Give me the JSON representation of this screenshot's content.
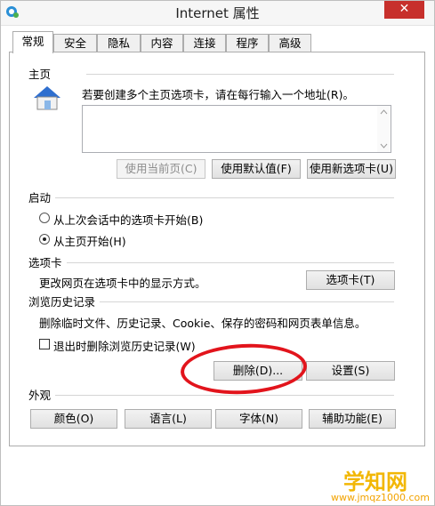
{
  "window": {
    "title": "Internet 属性",
    "close_glyph": "✕"
  },
  "tabs": [
    {
      "label": "常规",
      "active": true
    },
    {
      "label": "安全"
    },
    {
      "label": "隐私"
    },
    {
      "label": "内容"
    },
    {
      "label": "连接"
    },
    {
      "label": "程序"
    },
    {
      "label": "高级"
    }
  ],
  "homepage": {
    "heading": "主页",
    "instruction": "若要创建多个主页选项卡，请在每行输入一个地址(R)。",
    "textarea_value": "",
    "buttons": {
      "use_current": "使用当前页(C)",
      "use_default": "使用默认值(F)",
      "use_new_tab": "使用新选项卡(U)"
    }
  },
  "startup": {
    "heading": "启动",
    "option_last_session": "从上次会话中的选项卡开始(B)",
    "option_home": "从主页开始(H)",
    "selected": "home"
  },
  "tabs_section": {
    "heading": "选项卡",
    "description": "更改网页在选项卡中的显示方式。",
    "button": "选项卡(T)"
  },
  "history": {
    "heading": "浏览历史记录",
    "description": "删除临时文件、历史记录、Cookie、保存的密码和网页表单信息。",
    "checkbox_label": "退出时删除浏览历史记录(W)",
    "checkbox_checked": false,
    "delete_button": "删除(D)...",
    "settings_button": "设置(S)"
  },
  "appearance": {
    "heading": "外观",
    "buttons": {
      "colors": "颜色(O)",
      "languages": "语言(L)",
      "fonts": "字体(N)",
      "accessibility": "辅助功能(E)"
    }
  },
  "watermark": {
    "main": "学知网",
    "url": "www.jmqz1000.com"
  },
  "colors": {
    "close_red": "#c7302c",
    "annotation_red": "#e2141c",
    "watermark": "#f2b705"
  },
  "icons": {
    "app": "ie-settings-icon",
    "home": "house-icon"
  }
}
